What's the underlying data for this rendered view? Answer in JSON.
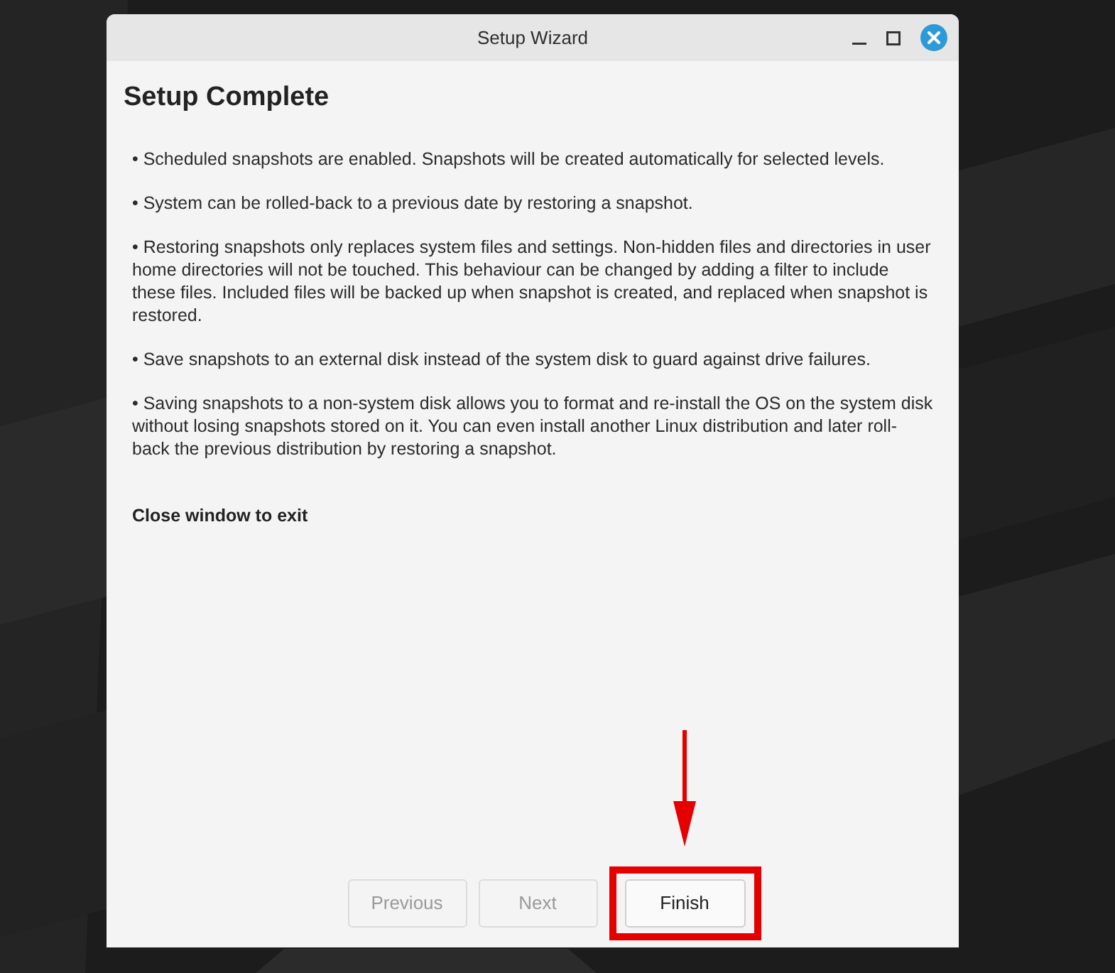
{
  "window": {
    "title": "Setup Wizard"
  },
  "heading": "Setup Complete",
  "paragraphs": [
    "• Scheduled snapshots are enabled. Snapshots will be created automatically for selected levels.",
    "• System can be rolled-back to a previous date by restoring a snapshot.",
    "• Restoring snapshots only replaces system files and settings. Non-hidden files and directories in user home directories will not be touched. This behaviour can be changed by adding a filter to include these files. Included files will be backed up when snapshot is created, and replaced when snapshot is restored.",
    "• Save snapshots to an external disk instead of the system disk to guard against drive failures.",
    "• Saving snapshots to a non-system disk allows you to format and re-install the OS on the system disk without losing snapshots stored on it. You can even install another Linux distribution and later roll-back the previous distribution by restoring a snapshot."
  ],
  "exit_note": "Close window to exit",
  "buttons": [
    {
      "label": "Previous",
      "disabled": true,
      "highlighted": false
    },
    {
      "label": "Next",
      "disabled": true,
      "highlighted": false
    },
    {
      "label": "Finish",
      "disabled": false,
      "highlighted": true
    }
  ]
}
